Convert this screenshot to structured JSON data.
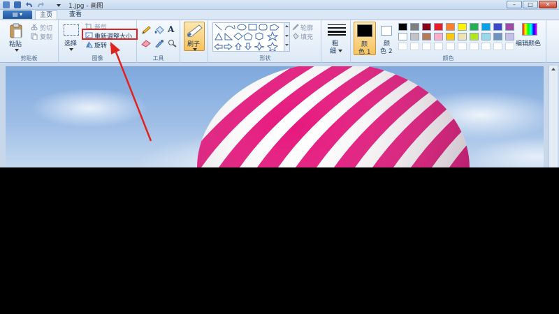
{
  "window": {
    "title": "1.jpg - 画图",
    "minimize_label": "–",
    "maximize_label": "□",
    "close_label": "✕"
  },
  "menu": {
    "file_label": "▤ ▾",
    "tabs": [
      {
        "label": "主页",
        "selected": true
      },
      {
        "label": "查看",
        "selected": false
      }
    ]
  },
  "ribbon": {
    "clipboard": {
      "paste_label": "粘贴",
      "cut_label": "剪切",
      "copy_label": "复制",
      "group_label": "剪贴板"
    },
    "image": {
      "select_label": "选择",
      "crop_label": "裁剪",
      "resize_label": "重新调整大小",
      "rotate_label": "旋转",
      "group_label": "图像"
    },
    "tools": {
      "group_label": "工具",
      "text_tool_label": "A"
    },
    "brushes": {
      "label": "刷子"
    },
    "shapes": {
      "outline_label": "轮廓",
      "fill_label": "填充",
      "group_label": "形状"
    },
    "size": {
      "label_line1": "粗",
      "label_line2": "细"
    },
    "colors": {
      "color1_line1": "颜",
      "color1_line2": "色 1",
      "color2_line1": "颜",
      "color2_line2": "色 2",
      "edit_colors_label": "编辑颜色",
      "group_label": "颜色",
      "color1_value": "#000000",
      "color2_value": "#ffffff",
      "palette_row1": [
        "#000000",
        "#7f7f7f",
        "#880015",
        "#ed1c24",
        "#ff7f27",
        "#fff200",
        "#22b14c",
        "#00a2e8",
        "#3f48cc",
        "#a349a4"
      ],
      "palette_row2": [
        "#ffffff",
        "#c3c3c3",
        "#b97a57",
        "#ffaec9",
        "#ffc90e",
        "#efe4b0",
        "#b5e61d",
        "#99d9ea",
        "#7092be",
        "#c8bfe7"
      ]
    }
  },
  "canvas": {
    "image_subject": "hot-air-balloon",
    "balloon_colors": [
      "#e6177d",
      "#ffffff"
    ]
  },
  "annotation": {
    "highlight_color": "#e0231f"
  }
}
